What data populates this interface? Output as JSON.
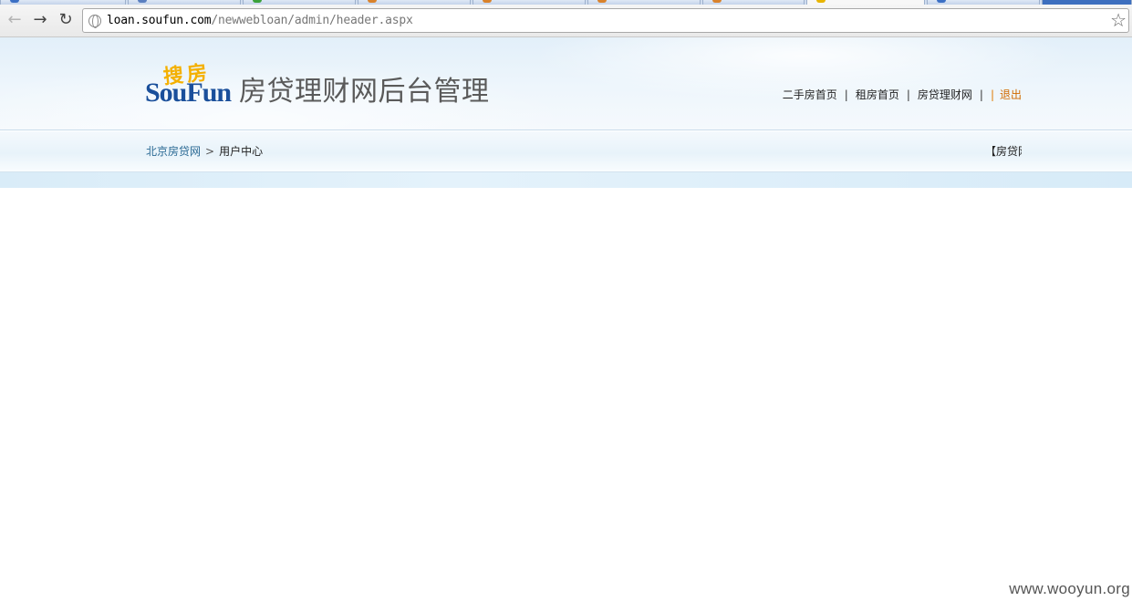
{
  "browser": {
    "url_host": "loan.soufun.com",
    "url_path": "/newwebloan/admin/header.aspx",
    "icons": [
      "back-arrow-icon",
      "forward-arrow-icon",
      "reload-icon",
      "globe-icon",
      "bookmark-star-icon"
    ]
  },
  "header": {
    "logo_cn": "搜房",
    "logo_en": "SouFun",
    "title": "房贷理财网后台管理",
    "links": {
      "secondhand": "二手房首页",
      "rent": "租房首页",
      "loan_finance": "房贷理财网",
      "logout": "退出",
      "separator": "|"
    }
  },
  "breadcrumb": {
    "home": "北京房贷网",
    "arrow": ">",
    "current": "用户中心"
  },
  "right_clipped_text": "【房贷网",
  "watermark": "www.wooyun.org",
  "colors": {
    "logo_blue": "#1a4f9b",
    "logo_yellow": "#f4b000",
    "logout_orange": "#d06a00",
    "breadcrumb_link": "#2b6a94"
  }
}
